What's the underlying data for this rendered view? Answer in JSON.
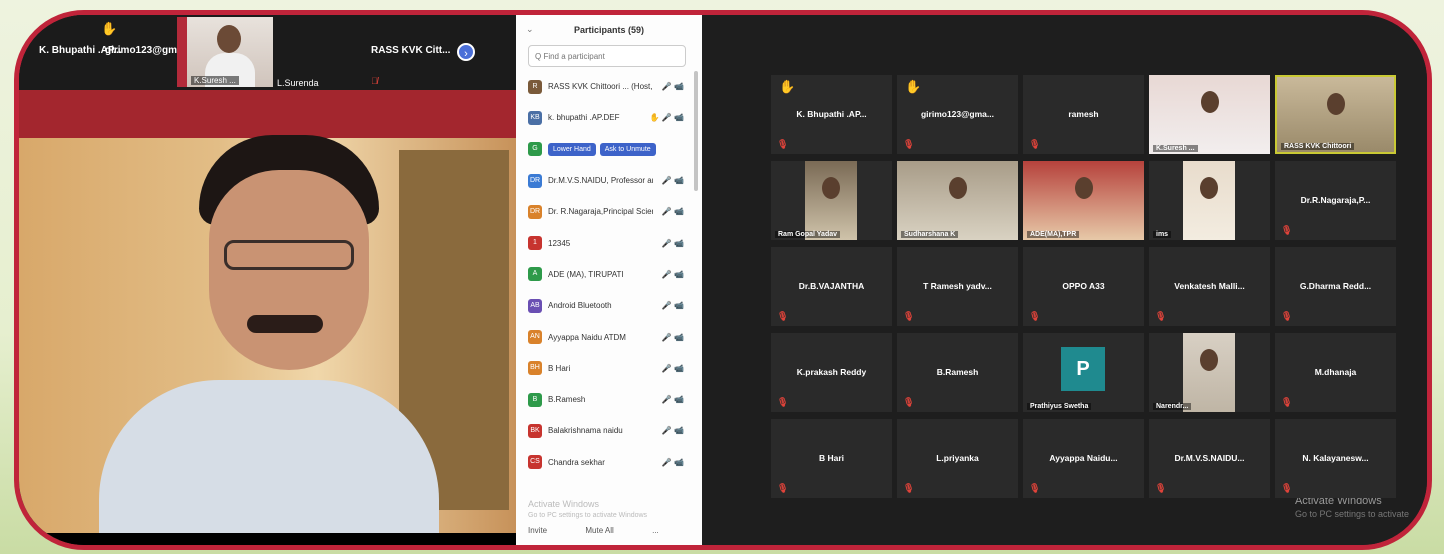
{
  "left_panel": {
    "strip": {
      "tile1_name": "K. Bhupathi .AP...",
      "tile2_name": "girimo123@gma...",
      "tile3_label": "K.Suresh ...",
      "tile4_label": "L.Surenda",
      "tile5_name": "RASS KVK Citt...",
      "nav_icon": "chevron-right-icon"
    },
    "main_speaker": "presenter-video"
  },
  "participants_panel": {
    "title": "Participants (59)",
    "search_placeholder": "Q Find a participant",
    "rows": [
      {
        "initial": "R",
        "color": "#7a5a3a",
        "name": "RASS KVK Chittoori ... (Host, me)",
        "icons": "🎤 📹"
      },
      {
        "initial": "KB",
        "color": "#4a6fa5",
        "name": "k. bhupathi .AP.DEF",
        "icons": "🎤 📹",
        "hand": true
      },
      {
        "initial": "G",
        "color": "#2e9a4a",
        "name": "",
        "buttons": [
          "Lower Hand",
          "Ask to Unmute"
        ]
      },
      {
        "initial": "DR",
        "color": "#3b7bd4",
        "name": "Dr.M.V.S.NAIDU, Professor and...",
        "icons": "🎤 📹"
      },
      {
        "initial": "DR",
        "color": "#d9822b",
        "name": "Dr. R.Nagaraja,Principal Scientist...",
        "icons": "🎤 📹"
      },
      {
        "initial": "1",
        "color": "#c7342f",
        "name": "12345",
        "icons": "🎤 📹"
      },
      {
        "initial": "A",
        "color": "#2e9a4a",
        "name": "ADE (MA), TIRUPATI",
        "icons": "🎤 📹"
      },
      {
        "initial": "AB",
        "color": "#6a4fb3",
        "name": "Android Bluetooth",
        "icons": "🎤 📹"
      },
      {
        "initial": "AN",
        "color": "#d9822b",
        "name": "Ayyappa Naidu ATDM",
        "icons": "🎤 📹"
      },
      {
        "initial": "BH",
        "color": "#d9822b",
        "name": "B Hari",
        "icons": "🎤 📹"
      },
      {
        "initial": "B",
        "color": "#2e9a4a",
        "name": "B.Ramesh",
        "icons": "🎤 📹"
      },
      {
        "initial": "BK",
        "color": "#c7342f",
        "name": "Balakrishnama naidu",
        "icons": "🎤 📹"
      },
      {
        "initial": "CS",
        "color": "#c7342f",
        "name": "Chandra sekhar",
        "icons": "🎤 📹"
      }
    ],
    "watermark_line1": "Activate Windows",
    "watermark_line2": "Go to PC settings to activate Windows",
    "footer_invite": "Invite",
    "footer_mute": "Mute All",
    "footer_more": "..."
  },
  "gallery": {
    "tiles": [
      {
        "name": "K. Bhupathi .AP...",
        "hand": true
      },
      {
        "name": "girimo123@gma...",
        "hand": true
      },
      {
        "name": "ramesh"
      },
      {
        "video": "man-white-shirt",
        "label": "K.Suresh ..."
      },
      {
        "video": "man-headset",
        "label": "RASS KVK Chittoori",
        "active": true
      },
      {
        "video": "person-sitting",
        "label": "Ram Gopal Yadav"
      },
      {
        "video": "man-desk",
        "label": "Sudharshana K"
      },
      {
        "video": "woman-green",
        "label": "ADE(MA),TPR"
      },
      {
        "video": "room-window",
        "label": "ims"
      },
      {
        "name": "Dr.R.Nagaraja,P..."
      },
      {
        "name": "Dr.B.VAJANTHA"
      },
      {
        "name": "T Ramesh yadv..."
      },
      {
        "name": "OPPO A33"
      },
      {
        "name": "Venkatesh Malli..."
      },
      {
        "name": "G.Dharma Redd..."
      },
      {
        "name": "K.prakash Reddy"
      },
      {
        "name": "B.Ramesh"
      },
      {
        "avatar": "P",
        "label": "Prathiyus Swetha"
      },
      {
        "video": "man-mask",
        "label": "Narendr..."
      },
      {
        "name": "M.dhanaja"
      },
      {
        "name": "B Hari"
      },
      {
        "name": "L.priyanka"
      },
      {
        "name": "Ayyappa Naidu..."
      },
      {
        "name": "Dr.M.V.S.NAIDU..."
      },
      {
        "name": "N. Kalayanesw..."
      }
    ],
    "activate_line1": "Activate Windows",
    "activate_line2": "Go to PC settings to activate"
  }
}
